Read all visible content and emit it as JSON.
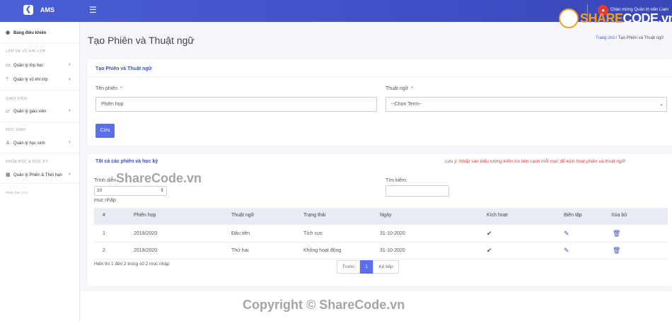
{
  "app": {
    "brand": "AMS",
    "welcome": "Chào mừng Quản trị viên Liam"
  },
  "sharecode_logo": {
    "left": "SHARE",
    "right": "CODE.vn"
  },
  "sidebar": {
    "dashboard": "Bảng điều khiển",
    "section_class": "LỚP VÀ VŨ KHÍ LỚP",
    "manage_class": "Quản lý lớp học",
    "manage_weapon": "Quản lý vũ khí lớp",
    "section_teacher": "GIÁO VIÊN",
    "manage_teacher": "Quản lý giáo viên",
    "section_student": "HỌC SINH",
    "manage_student": "Quản lý học sinh",
    "section_session": "KHÓA HỌC & HỌC KỲ",
    "manage_session": "Quản lý Phiên & Thời hạn",
    "version": "Phiên bản 1.0.0"
  },
  "page": {
    "title": "Tạo Phiên và Thuật ngữ",
    "crumb_home": "Trang chủ",
    "crumb_sep": "/",
    "crumb_current": "Tạo Phiên và Thuật ngữ"
  },
  "form": {
    "title": "Tạo Phiên và Thuật ngữ",
    "session_label": "Tên phiên",
    "session_value": "Phiên họp",
    "term_label": "Thuật ngữ",
    "term_value": "--Chọn Term--",
    "required": "*",
    "save": "Cứu"
  },
  "list": {
    "title": "Tất cả các phiên và học kỳ",
    "note": "Lưu ý: Nhấp vào biểu tượng kiểm tra bên cạnh mỗi mục để kích hoạt phiên và thuật ngữ!",
    "show_label": "Trình diễn",
    "show_value": "10",
    "entries_label": "mục nhập",
    "search_label": "Tìm kiếm:",
    "columns": [
      "#",
      "Phiên họp",
      "Thuật ngữ",
      "Trạng thái",
      "Ngày",
      "Kích hoạt",
      "Biên tập",
      "Xóa bỏ"
    ],
    "rows": [
      {
        "no": "1",
        "session": "2019/2020",
        "term": "Đầu tiên",
        "status": "Tích cực",
        "date": "31-10-2020"
      },
      {
        "no": "2",
        "session": "2019/2020",
        "term": "Thứ hai",
        "status": "Không hoạt động",
        "date": "31-10-2020"
      }
    ],
    "info": "Hiển thị 1 đến 2 trong số 2 mục nhập",
    "prev": "Trước",
    "page": "1",
    "next": "Kế tiếp"
  },
  "watermark": {
    "top": "ShareCode.vn",
    "bottom": "Copyright © ShareCode.vn"
  }
}
